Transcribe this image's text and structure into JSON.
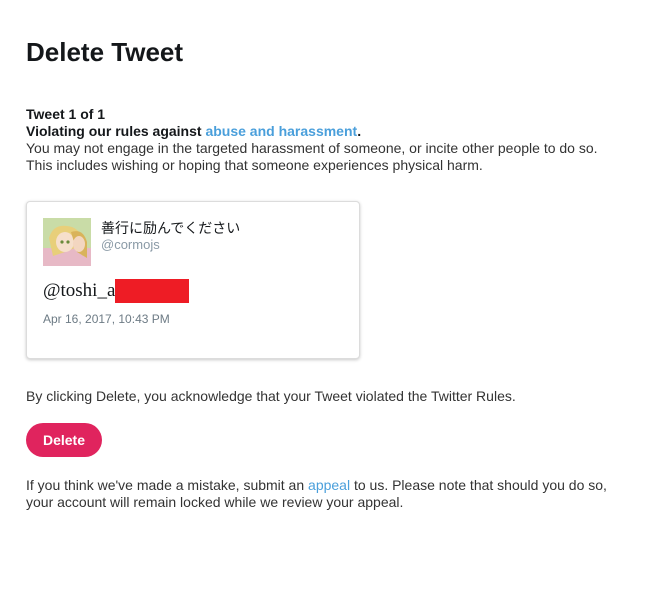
{
  "page": {
    "title": "Delete Tweet"
  },
  "violation": {
    "count": "Tweet 1 of 1",
    "rule_prefix": "Violating our rules against ",
    "rule_link": "abuse and harassment",
    "rule_suffix": ".",
    "line1": "You may not engage in the targeted harassment of someone, or incite other people to do so.",
    "line2": "This includes wishing or hoping that someone experiences physical harm."
  },
  "tweet": {
    "display_name": "善行に励んでください",
    "handle": "@cormojs",
    "text": "@toshi_a",
    "timestamp": "Apr 16, 2017, 10:43 PM"
  },
  "acknowledge": "By clicking Delete, you acknowledge that your Tweet violated the Twitter Rules.",
  "delete_label": "Delete",
  "appeal": {
    "prefix": "If you think we've made a mistake, submit an ",
    "link": "appeal",
    "suffix": " to us. Please note that should you do so,",
    "line2": "your account will remain locked while we review your appeal."
  },
  "colors": {
    "accent": "#e0245e",
    "link": "#4a9fdb",
    "redaction": "#ee1c25"
  }
}
